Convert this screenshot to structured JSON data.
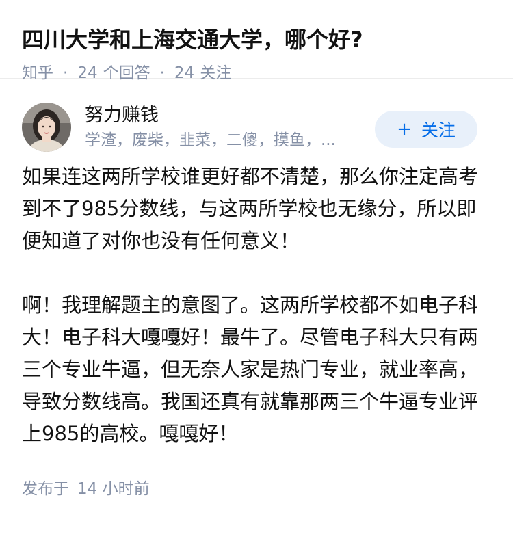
{
  "question": {
    "title": "四川大学和上海交通大学，哪个好?",
    "source": "知乎",
    "answers_count": "24",
    "answers_label": "个回答",
    "followers_count": "24",
    "followers_label": "关注",
    "separator": "·"
  },
  "answer": {
    "author": {
      "name": "努力赚钱",
      "bio": "学渣，废柴，韭菜，二傻，摸鱼，...",
      "avatar_icon": "avatar-photo-icon"
    },
    "follow_button": {
      "plus": "+",
      "label": "关注"
    },
    "paragraphs": [
      "如果连这两所学校谁更好都不清楚，那么你注定高考到不了985分数线，与这两所学校也无缘分，所以即便知道了对你也没有任何意义！",
      "啊！我理解题主的意图了。这两所学校都不如电子科大！电子科大嘎嘎好！最牛了。尽管电子科大只有两三个专业牛逼，但无奈人家是热门专业，就业率高，导致分数线高。我国还真有就靠那两三个牛逼专业评上985的高校。嘎嘎好！"
    ],
    "posted_prefix": "发布于",
    "posted_time": "14 小时前"
  },
  "colors": {
    "accent": "#056de8",
    "accent_bg": "#e8f0fa",
    "meta_text": "#8590a6",
    "body_text": "#121212"
  }
}
